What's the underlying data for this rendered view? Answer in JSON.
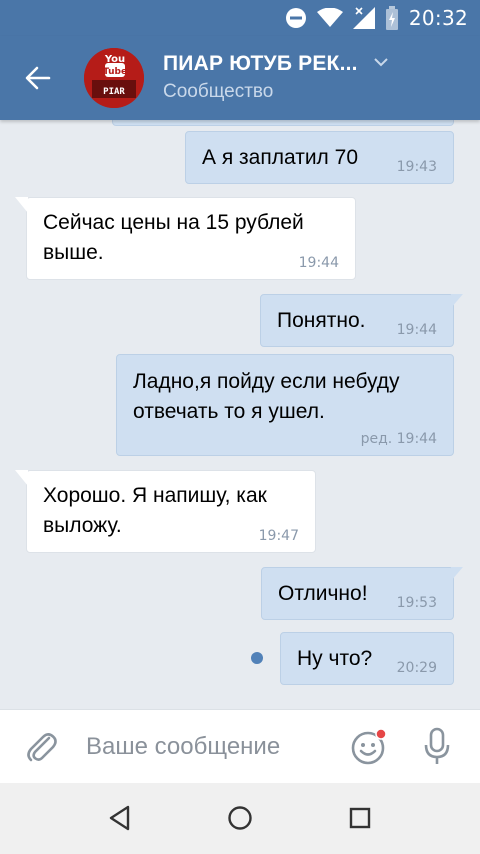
{
  "status_bar": {
    "time": "20:32"
  },
  "header": {
    "title": "ПИАР ЮТУБ РЕК...",
    "subtitle": "Сообщество",
    "avatar_text_top": "You",
    "avatar_text_mid": "Tube",
    "avatar_text_bottom": "PIAR"
  },
  "messages": [
    {
      "direction": "out",
      "text": "А я заплатил 70",
      "time": "19:43"
    },
    {
      "direction": "in",
      "text": "Сейчас цены на 15 рублей\nвыше.",
      "time": "19:44"
    },
    {
      "direction": "out",
      "text": "Понятно.",
      "time": "19:44"
    },
    {
      "direction": "out",
      "text": "Ладно,я пойду если небуду\nотвечать то я ушел.",
      "time": "ред. 19:44"
    },
    {
      "direction": "in",
      "text": "Хорошо. Я напишу, как\nвыложу.",
      "time": "19:47"
    },
    {
      "direction": "out",
      "text": "Отлично!",
      "time": "19:53"
    },
    {
      "direction": "out",
      "text": "Ну что?",
      "time": "20:29",
      "unread": true
    }
  ],
  "composer": {
    "placeholder": "Ваше сообщение"
  },
  "colors": {
    "header": "#4a76a8",
    "outgoing": "#cfdff1",
    "incoming": "#ffffff",
    "background": "#e7ebf0",
    "unread_dot": "#5181b8",
    "badge": "#e64646"
  },
  "icons": [
    "back-arrow-icon",
    "chevron-down-icon",
    "attach-icon",
    "emoji-icon",
    "mic-icon",
    "nav-back-icon",
    "nav-home-icon",
    "nav-recents-icon",
    "dnd-icon",
    "wifi-icon",
    "signal-icon",
    "battery-icon"
  ]
}
